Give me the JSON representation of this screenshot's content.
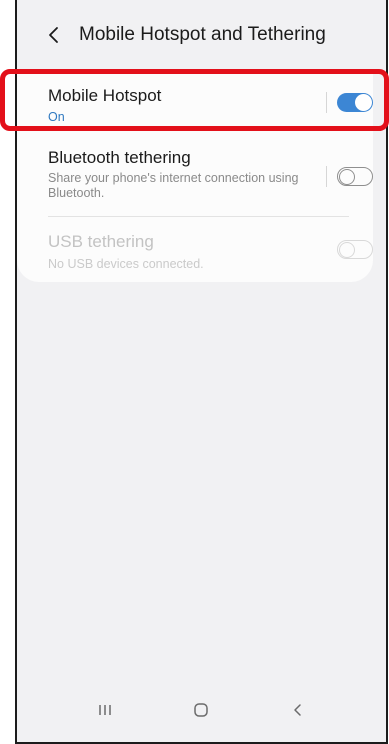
{
  "header": {
    "title": "Mobile Hotspot and Tethering",
    "back_icon": "chevron-left-icon"
  },
  "items": [
    {
      "title": "Mobile Hotspot",
      "status": "On",
      "toggle": "on",
      "enabled": true
    },
    {
      "title": "Bluetooth tethering",
      "subtitle": "Share your phone's internet connection using Bluetooth.",
      "toggle": "off",
      "enabled": true
    },
    {
      "title": "USB tethering",
      "subtitle": "No USB devices connected.",
      "toggle": "off",
      "enabled": false
    }
  ],
  "navbar": {
    "recents_icon": "recents-icon",
    "home_icon": "home-icon",
    "back_icon": "back-icon"
  },
  "colors": {
    "accent": "#3c86d4",
    "status_on": "#2f79c0",
    "highlight": "#e3101a",
    "background": "#f1f1f3"
  }
}
